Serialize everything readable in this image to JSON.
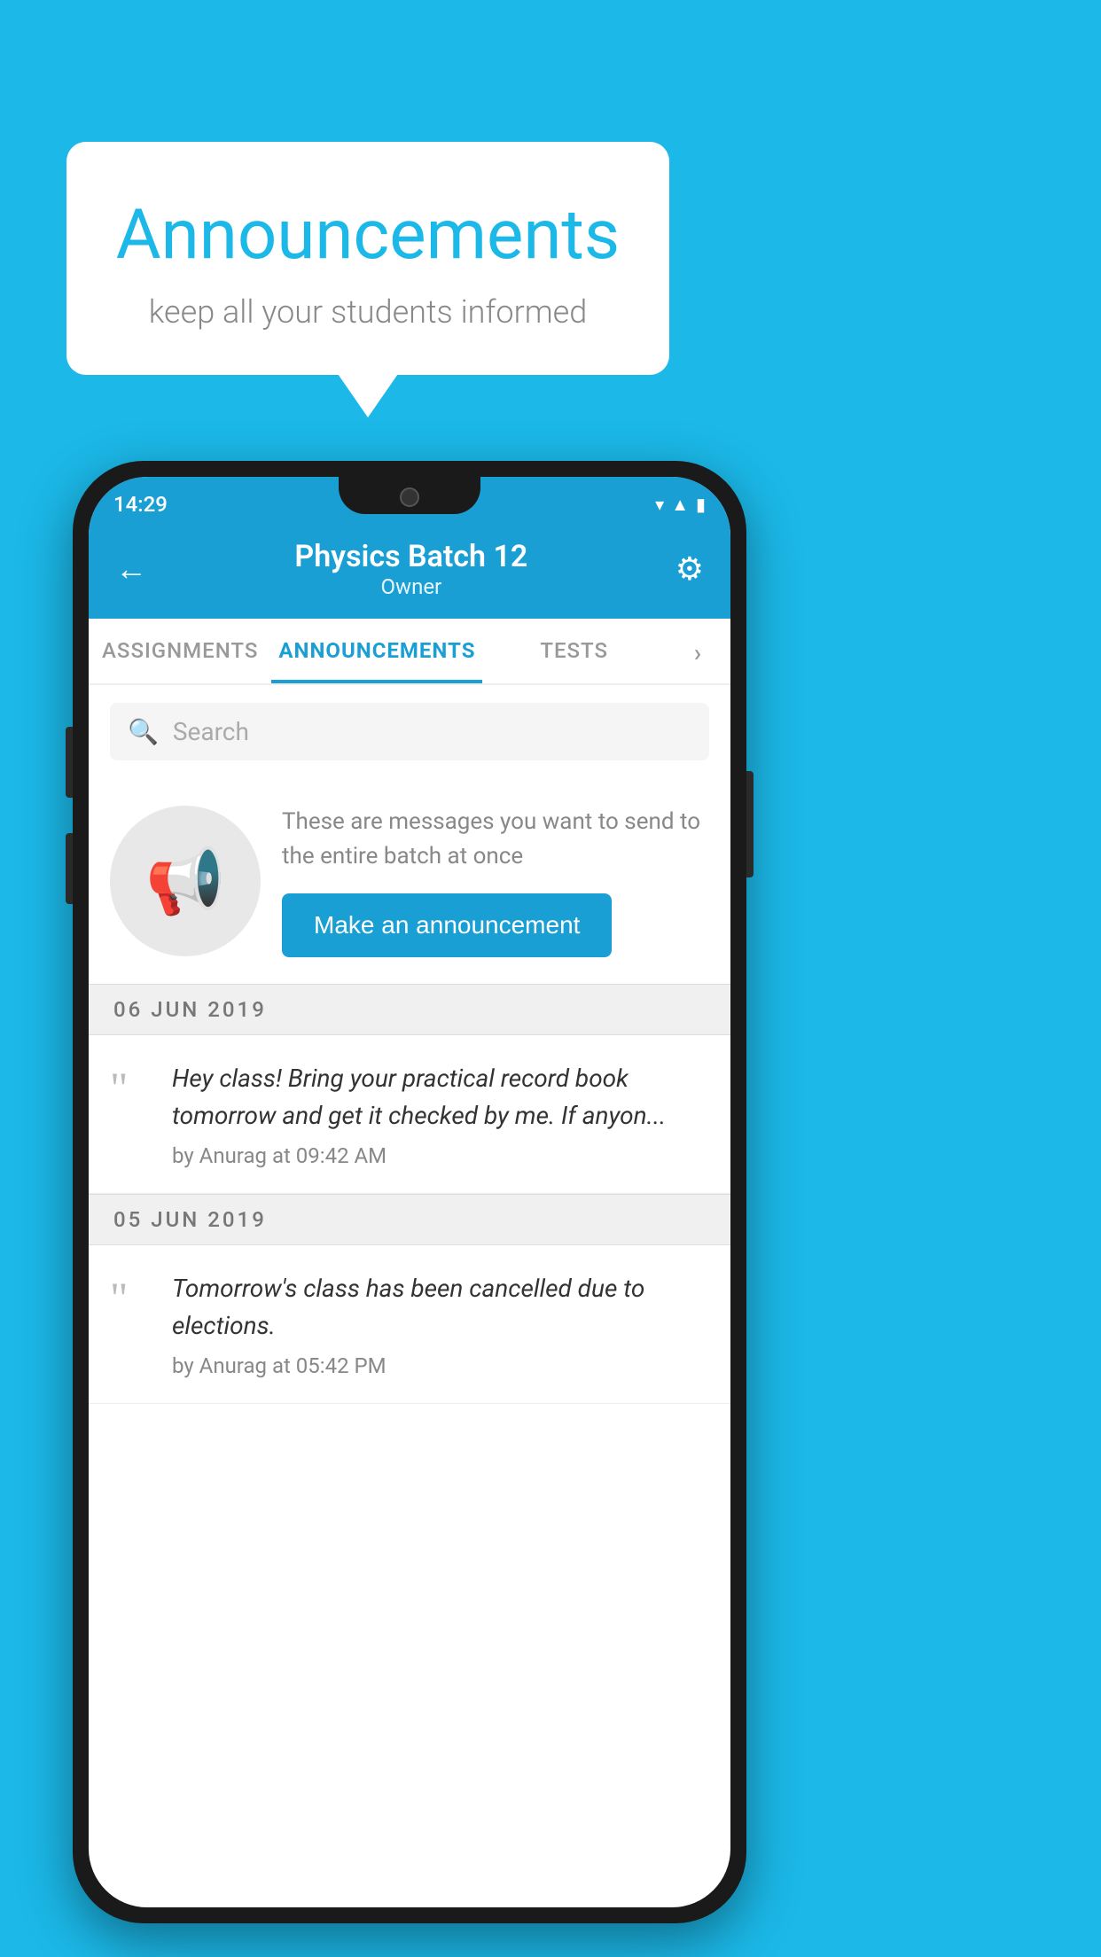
{
  "background_color": "#1bb8e8",
  "bubble": {
    "title": "Announcements",
    "subtitle": "keep all your students informed"
  },
  "phone": {
    "status_bar": {
      "time": "14:29",
      "icons": [
        "wifi",
        "signal",
        "battery"
      ]
    },
    "header": {
      "back_label": "←",
      "title": "Physics Batch 12",
      "subtitle": "Owner",
      "gear_label": "⚙"
    },
    "tabs": [
      {
        "label": "ASSIGNMENTS",
        "active": false
      },
      {
        "label": "ANNOUNCEMENTS",
        "active": true
      },
      {
        "label": "TESTS",
        "active": false
      },
      {
        "label": "...",
        "active": false
      }
    ],
    "search": {
      "placeholder": "Search"
    },
    "promo": {
      "description": "These are messages you want to send to the entire batch at once",
      "button_label": "Make an announcement"
    },
    "announcements": [
      {
        "date": "06  JUN  2019",
        "items": [
          {
            "text": "Hey class! Bring your practical record book tomorrow and get it checked by me. If anyon...",
            "meta": "by Anurag at 09:42 AM"
          }
        ]
      },
      {
        "date": "05  JUN  2019",
        "items": [
          {
            "text": "Tomorrow's class has been cancelled due to elections.",
            "meta": "by Anurag at 05:42 PM"
          }
        ]
      }
    ]
  }
}
